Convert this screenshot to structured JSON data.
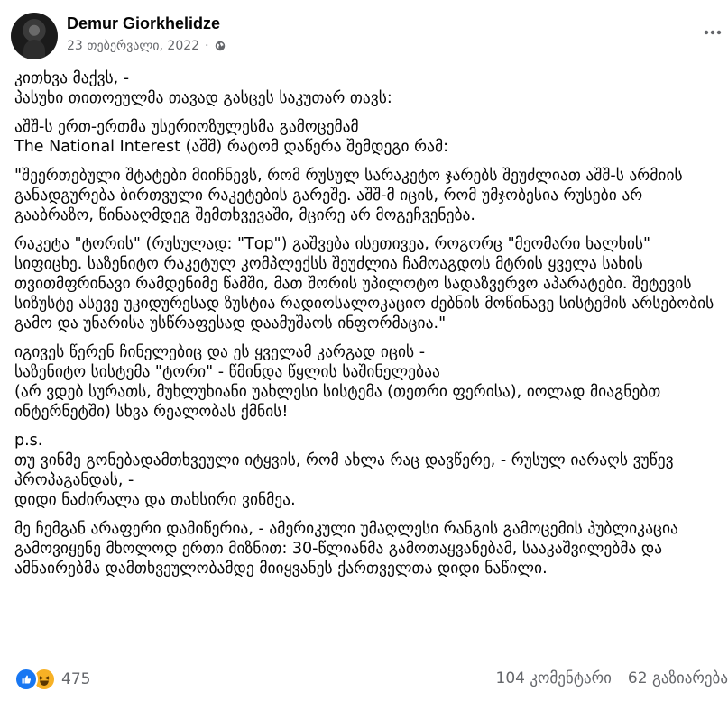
{
  "header": {
    "author": "Demur Giorkhelidze",
    "date": "23 თებერვალი, 2022",
    "separator": "·",
    "privacy_icon": "globe-icon",
    "more_icon": "more-options-icon"
  },
  "post": {
    "paragraphs": [
      "კითხვა მაქვს, -\nპასუხი თითოეულმა თავად გასცეს საკუთარ თავს:",
      "აშშ-ს ერთ-ერთმა უსერიოზულესმა გამოცემამ\nThe National Interest (აშშ) რატომ დაწერა შემდეგი რამ:",
      "\"შეერთებული შტატები მიიჩნევს, რომ რუსულ სარაკეტო ჯარებს შეუძლიათ აშშ-ს არმიის განადგურება ბირთვული რაკეტების გარეშე. აშშ-მ იცის, რომ უმჯობესია რუსები არ გააბრაზო, წინააღმდეგ შემთხვევაში, მცირე არ  მოგეჩვენება.",
      "რაკეტა \"ტორის\" (რუსულად: \"Тор\") გაშვება ისეთივეა, როგორც \"მეომარი ხალხის\" სიფიცხე. საზენიტო რაკეტულ კომპლექსს შეუძლია ჩამოაგდოს მტრის ყველა სახის თვითმფრინავი რამდენიმე წამში, მათ შორის უპილოტო სადაზვერვო აპარატები. შეტევის სიზუსტე ასევე უკიდურესად ზუსტია რადიოსალოკაციო ძებნის მოწინავე სისტემის არსებობის გამო და უნარისა უსწრაფესად დაამუშაოს ინფორმაცია.\"",
      "იგივეს წერენ ჩინელებიც და ეს ყველამ კარგად იცის -\nსაზენიტო სისტემა \"ტორი\" - წმინდა წყლის საშინელებაა\n(არ ვდებ სურათს, მუხლუხიანი უახლესი სისტემა (თეთრი ფერისა), იოლად მიაგნებთ ინტერნეტში) სხვა რეალობას ქმნის!",
      "p.s.\nთუ ვინმე გონებადამთხვეული იტყვის, რომ ახლა რაც დავწერე, - რუსულ იარაღს ვუწევ პროპაგანდას, -\nდიდი ნაძირალა და თახსირი ვინმეა.",
      "მე ჩემგან არაფერი დამიწერია, - ამერიკული უმაღლესი რანგის გამოცემის პუბლიკაცია გამოვიყენე მხოლოდ ერთი მიზნით: 30-წლიანმა გამოთაყვანებამ, სააკაშვილებმა და ამნაირებმა დამთხვეულობამდე მიიყვანეს ქართველთა დიდი ნაწილი."
    ]
  },
  "footer": {
    "reaction_icons": [
      "like-icon",
      "haha-icon"
    ],
    "reaction_count": "475",
    "comments": "104 კომენტარი",
    "shares": "62 გაზიარება"
  },
  "colors": {
    "text": "#050505",
    "secondary": "#65676b",
    "like_blue": "#1877f2",
    "haha_yellow": "#f7b125"
  }
}
